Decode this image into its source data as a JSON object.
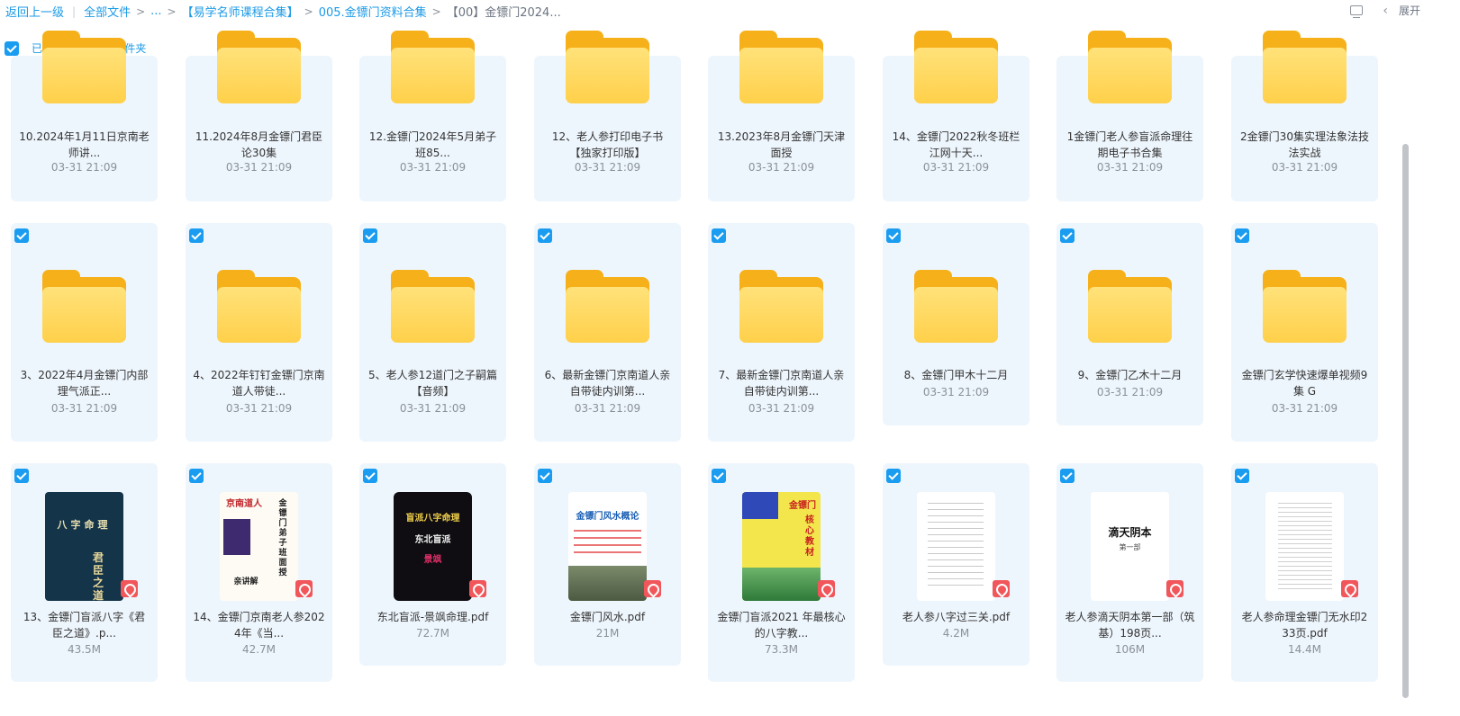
{
  "breadcrumb": {
    "back": "返回上一级",
    "all_files": "全部文件",
    "ellipsis": "...",
    "level1": "【易学名师课程合集】",
    "level2": "005.金镖门资料合集",
    "current": "【00】金镖门2024..."
  },
  "topbar": {
    "expand_label": "展开"
  },
  "selection": {
    "count_label": "已选中24个文件/文件夹"
  },
  "row1": [
    {
      "name": "10.2024年1月11日京南老师讲...",
      "meta": "03-31 21:09"
    },
    {
      "name": "11.2024年8月金镖门君臣论30集",
      "meta": "03-31 21:09"
    },
    {
      "name": "12.金镖门2024年5月弟子班85...",
      "meta": "03-31 21:09"
    },
    {
      "name": "12、老人参打印电子书【独家打印版】",
      "meta": "03-31 21:09"
    },
    {
      "name": "13.2023年8月金镖门天津面授",
      "meta": "03-31 21:09"
    },
    {
      "name": "14、金镖门2022秋冬班栏江网十天...",
      "meta": "03-31 21:09"
    },
    {
      "name": "1金镖门老人参盲派命理往期电子书合集",
      "meta": "03-31 21:09"
    },
    {
      "name": "2金镖门30集实理法象法技法实战",
      "meta": "03-31 21:09"
    }
  ],
  "row2": [
    {
      "name": "3、2022年4月金镖门内部理气派正...",
      "meta": "03-31 21:09"
    },
    {
      "name": "4、2022年钉钉金镖门京南道人带徒...",
      "meta": "03-31 21:09"
    },
    {
      "name": "5、老人参12道门之子嗣篇【音频】",
      "meta": "03-31 21:09"
    },
    {
      "name": "6、最新金镖门京南道人亲自带徒内训第...",
      "meta": "03-31 21:09"
    },
    {
      "name": "7、最新金镖门京南道人亲自带徒内训第...",
      "meta": "03-31 21:09"
    },
    {
      "name": "8、金镖门甲木十二月",
      "meta": "03-31 21:09"
    },
    {
      "name": "9、金镖门乙木十二月",
      "meta": "03-31 21:09"
    },
    {
      "name": "金镖门玄学快速爆单视频9集 G",
      "meta": "03-31 21:09"
    }
  ],
  "row3": [
    {
      "name": "13、金镖门盲派八字《君臣之道》.p...",
      "meta": "43.5M",
      "thumb_text": [
        "八字命理",
        "君臣之道"
      ]
    },
    {
      "name": "14、金镖门京南老人参2024年《当...",
      "meta": "42.7M",
      "thumb_text": [
        "京南道人",
        "金镖门弟子班面授",
        "亲讲解"
      ]
    },
    {
      "name": "东北盲派-景飒命理.pdf",
      "meta": "72.7M",
      "thumb_text": [
        "盲派八字命理",
        "东北盲派",
        "景飒"
      ]
    },
    {
      "name": "金镖门风水.pdf",
      "meta": "21M",
      "thumb_text": [
        "金镖门风水概论"
      ]
    },
    {
      "name": "金镖门盲派2021 年最核心的八字教...",
      "meta": "73.3M",
      "thumb_text": [
        "金镖门",
        "核心教材"
      ]
    },
    {
      "name": "老人参八字过三关.pdf",
      "meta": "4.2M",
      "thumb_text": []
    },
    {
      "name": "老人参滴天阴本第一部（筑基）198页...",
      "meta": "106M",
      "thumb_text": [
        "滴天阴本",
        "第一部"
      ]
    },
    {
      "name": "老人参命理金镖门无水印233页.pdf",
      "meta": "14.4M",
      "thumb_text": []
    }
  ]
}
